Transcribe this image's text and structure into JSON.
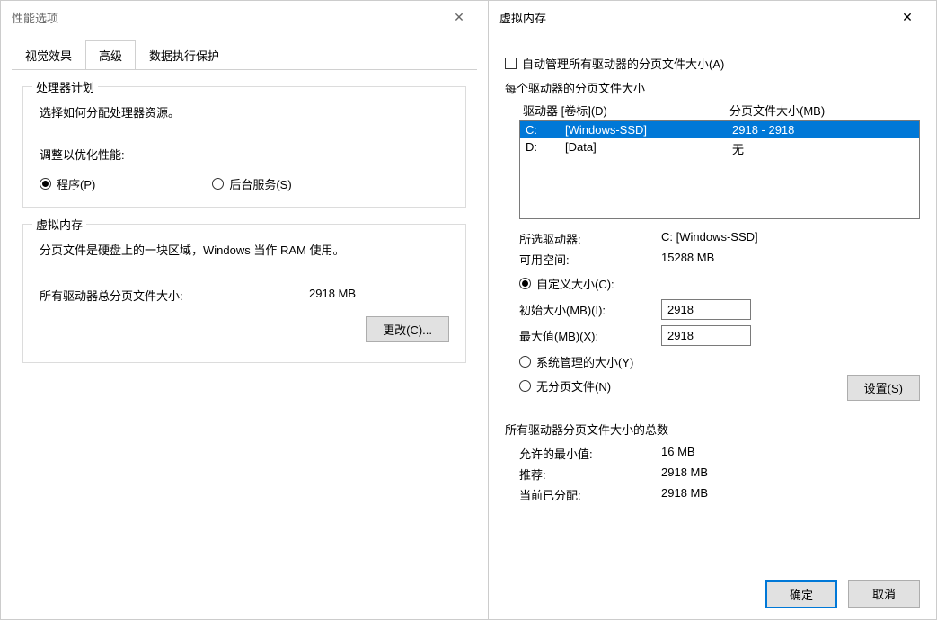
{
  "left": {
    "title": "性能选项",
    "tabs": [
      "视觉效果",
      "高级",
      "数据执行保护"
    ],
    "active_tab": 1,
    "processor_group": {
      "legend": "处理器计划",
      "desc": "选择如何分配处理器资源。",
      "adjust_label": "调整以优化性能:",
      "radio_programs": "程序(P)",
      "radio_background": "后台服务(S)",
      "selected": "programs"
    },
    "vm_group": {
      "legend": "虚拟内存",
      "desc": "分页文件是硬盘上的一块区域，Windows 当作 RAM 使用。",
      "total_label": "所有驱动器总分页文件大小:",
      "total_value": "2918 MB",
      "change_btn": "更改(C)..."
    }
  },
  "right": {
    "title": "虚拟内存",
    "auto_manage": "自动管理所有驱动器的分页文件大小(A)",
    "per_drive_legend": "每个驱动器的分页文件大小",
    "drive_header_col1": "驱动器 [卷标](D)",
    "drive_header_col2": "分页文件大小(MB)",
    "drives": [
      {
        "letter": "C:",
        "label": "[Windows-SSD]",
        "size": "2918 - 2918",
        "selected": true
      },
      {
        "letter": "D:",
        "label": "[Data]",
        "size": "无",
        "selected": false
      }
    ],
    "selected_drive_label": "所选驱动器:",
    "selected_drive_value": "C:  [Windows-SSD]",
    "free_space_label": "可用空间:",
    "free_space_value": "15288 MB",
    "radio_custom": "自定义大小(C):",
    "initial_label": "初始大小(MB)(I):",
    "initial_value": "2918",
    "max_label": "最大值(MB)(X):",
    "max_value": "2918",
    "radio_system": "系统管理的大小(Y)",
    "radio_none": "无分页文件(N)",
    "size_selected": "custom",
    "set_btn": "设置(S)",
    "totals_legend": "所有驱动器分页文件大小的总数",
    "min_label": "允许的最小值:",
    "min_value": "16 MB",
    "rec_label": "推荐:",
    "rec_value": "2918 MB",
    "cur_label": "当前已分配:",
    "cur_value": "2918 MB",
    "ok_btn": "确定",
    "cancel_btn": "取消"
  }
}
